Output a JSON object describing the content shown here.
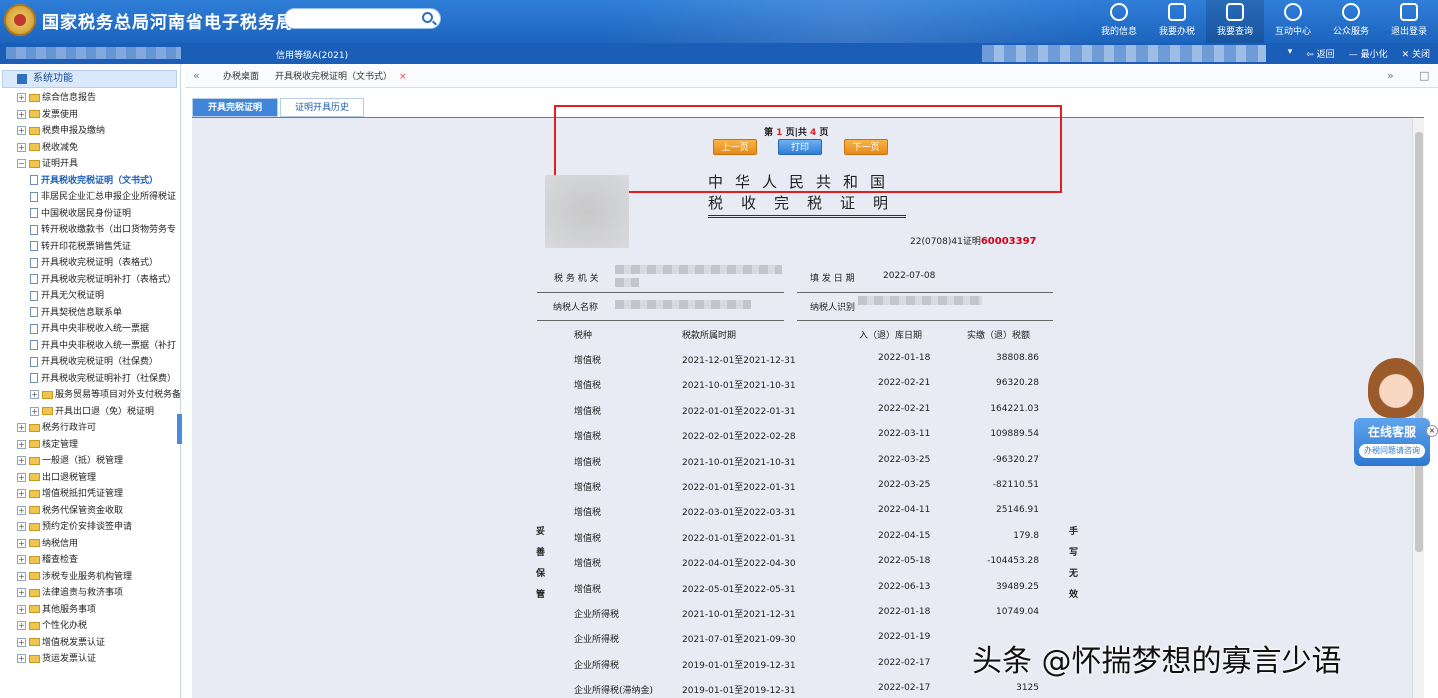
{
  "header": {
    "title": "国家税务总局河南省电子税务局",
    "nav": [
      {
        "label": "我的信息",
        "icon": "user-icon"
      },
      {
        "label": "我要办税",
        "icon": "monitor-icon"
      },
      {
        "label": "我要查询",
        "icon": "search-doc-icon"
      },
      {
        "label": "互动中心",
        "icon": "chat-icon"
      },
      {
        "label": "公众服务",
        "icon": "service-icon"
      },
      {
        "label": "退出登录",
        "icon": "logout-icon"
      }
    ]
  },
  "subbar": {
    "credit": "信用等级A(2021)",
    "back": "返回",
    "minimize": "最小化",
    "close": "关闭"
  },
  "sidebar": {
    "title": "系统功能",
    "items": [
      "综合信息报告",
      "发票使用",
      "税费申报及缴纳",
      "税收减免",
      "证明开具",
      "开具税收完税证明（文书式）",
      "非居民企业汇总申报企业所得税证",
      "中国税收居民身份证明",
      "转开税收缴款书（出口货物劳务专",
      "转开印花税票销售凭证",
      "开具税收完税证明（表格式）",
      "开具税收完税证明补打（表格式）",
      "开具无欠税证明",
      "开具契税信息联系单",
      "开具中央非税收入统一票据",
      "开具中央非税收入统一票据（补打",
      "开具税收完税证明（社保费）",
      "开具税收完税证明补打（社保费）",
      "服务贸易等项目对外支付税务备",
      "开具出口退（免）税证明",
      "税务行政许可",
      "核定管理",
      "一般退（抵）税管理",
      "出口退税管理",
      "增值税抵扣凭证管理",
      "税务代保管资金收取",
      "预约定价安排谈签申请",
      "纳税信用",
      "稽查检查",
      "涉税专业服务机构管理",
      "法律追责与救济事项",
      "其他服务事项",
      "个性化办税",
      "增值税发票认证",
      "货运发票认证"
    ]
  },
  "tabs": {
    "home": "办税桌面",
    "current": "开具税收完税证明（文书式）",
    "close": "×"
  },
  "inner_tabs": {
    "tab1": "开具完税证明",
    "tab2": "证明开具历史"
  },
  "pager": {
    "prefix": "第",
    "page": "1",
    "mid": "页|共",
    "total": "4",
    "suffix": "页",
    "prev": "上一页",
    "print": "打印",
    "next": "下一页"
  },
  "document": {
    "title1": "中华人民共和国",
    "title2": "税收完税证明",
    "cert_no_prefix": "22(0708)41证明",
    "cert_no": "60003397",
    "tax_office_label": "税 务 机 关",
    "issue_date_label": "填 发 日 期",
    "issue_date": "2022-07-08",
    "taxpayer_name_label": "纳税人名称",
    "taxpayer_id_label": "纳税人识别",
    "col_headers": [
      "税种",
      "税款所属时期",
      "入（退）库日期",
      "实缴（退）税额"
    ],
    "rows": [
      [
        "增值税",
        "2021-12-01至2021-12-31",
        "2022-01-18",
        "38808.86"
      ],
      [
        "增值税",
        "2021-10-01至2021-10-31",
        "2022-02-21",
        "96320.28"
      ],
      [
        "增值税",
        "2022-01-01至2022-01-31",
        "2022-02-21",
        "164221.03"
      ],
      [
        "增值税",
        "2022-02-01至2022-02-28",
        "2022-03-11",
        "109889.54"
      ],
      [
        "增值税",
        "2021-10-01至2021-10-31",
        "2022-03-25",
        "-96320.27"
      ],
      [
        "增值税",
        "2022-01-01至2022-01-31",
        "2022-03-25",
        "-82110.51"
      ],
      [
        "增值税",
        "2022-03-01至2022-03-31",
        "2022-04-11",
        "25146.91"
      ],
      [
        "增值税",
        "2022-01-01至2022-01-31",
        "2022-04-15",
        "179.8"
      ],
      [
        "增值税",
        "2022-04-01至2022-04-30",
        "2022-05-18",
        "-104453.28"
      ],
      [
        "增值税",
        "2022-05-01至2022-05-31",
        "2022-06-13",
        "39489.25"
      ],
      [
        "企业所得税",
        "2021-10-01至2021-12-31",
        "2022-01-18",
        "10749.04"
      ],
      [
        "企业所得税",
        "2021-07-01至2021-09-30",
        "2022-01-19",
        ""
      ],
      [
        "企业所得税",
        "2019-01-01至2019-12-31",
        "2022-02-17",
        ""
      ],
      [
        "企业所得税(滞纳金)",
        "2019-01-01至2019-12-31",
        "2022-02-17",
        "3125"
      ]
    ],
    "left_vertical": "妥善保管",
    "right_vertical": "手写无效"
  },
  "support": {
    "title": "在线客服",
    "sub": "办税问题请咨询",
    "close": "×"
  },
  "watermark": "头条 @怀揣梦想的寡言少语"
}
